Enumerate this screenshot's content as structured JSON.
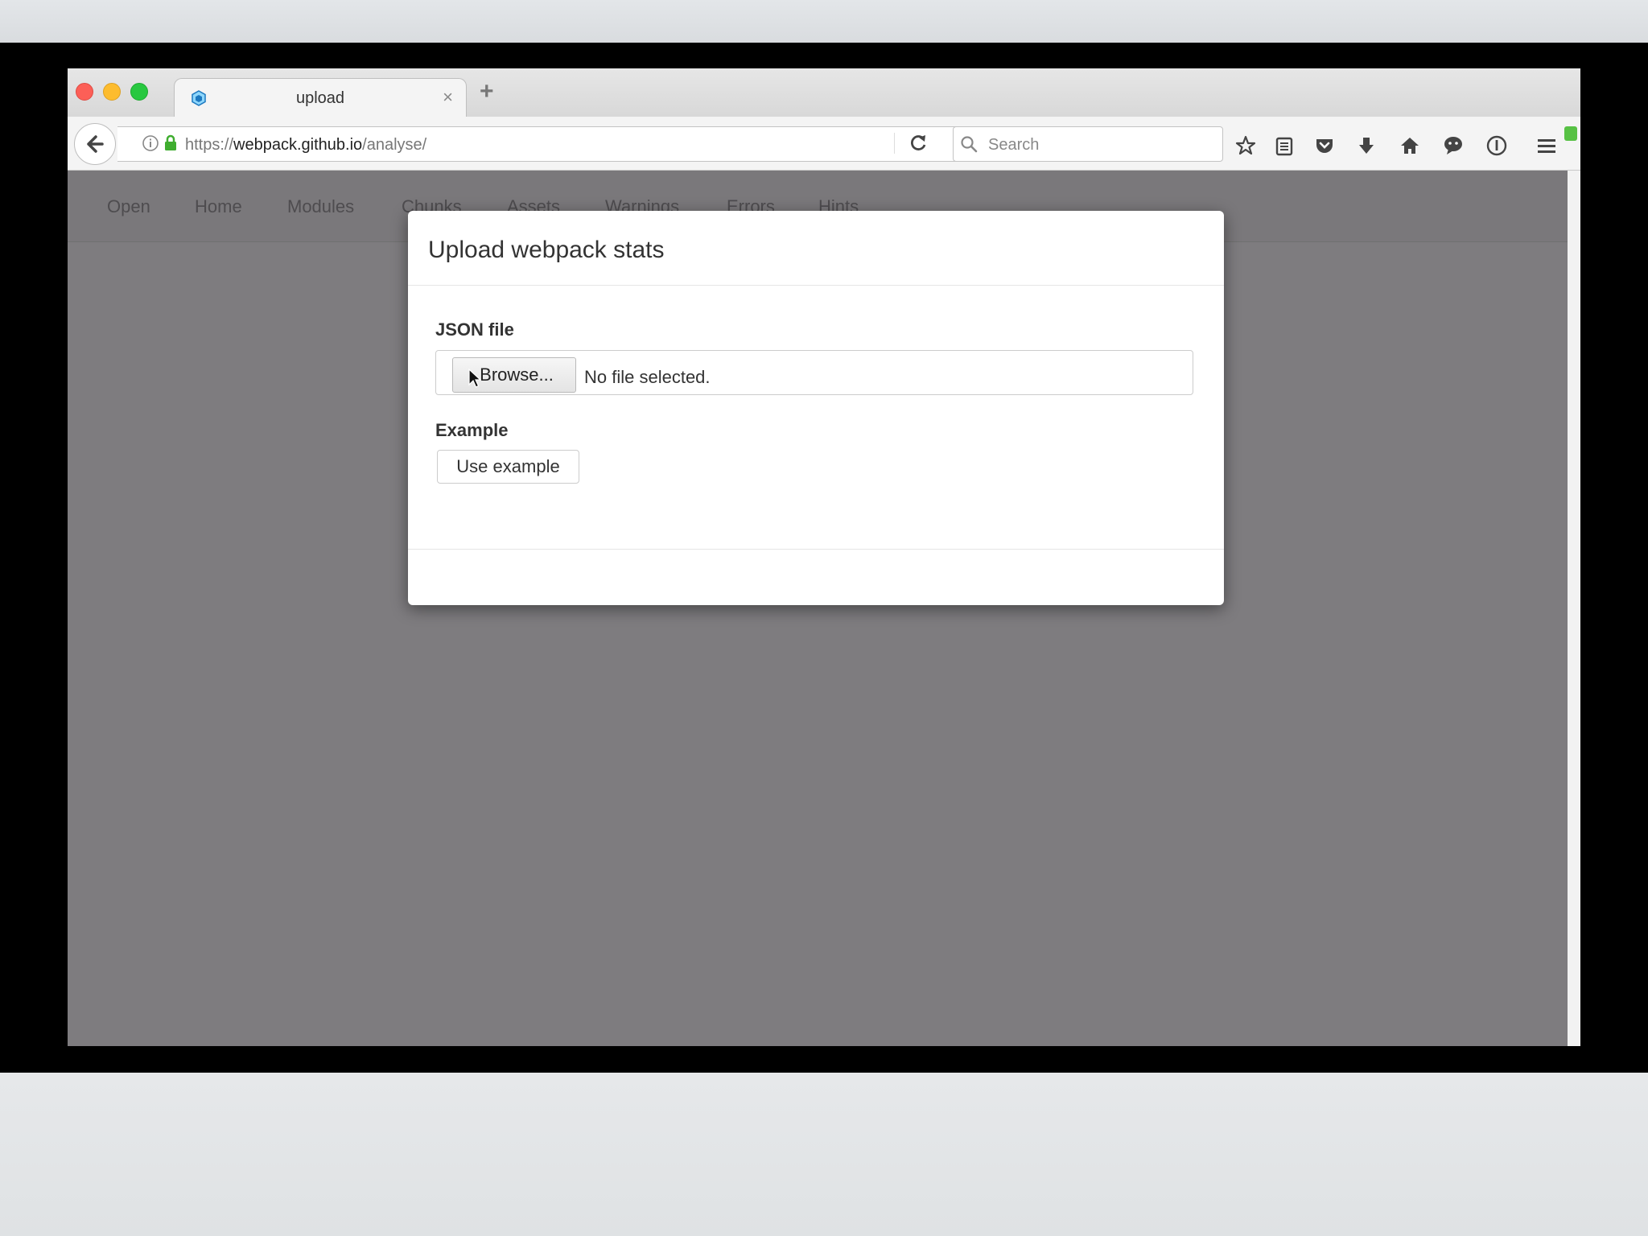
{
  "browser": {
    "tab": {
      "title": "upload",
      "close": "×"
    },
    "new_tab": "+",
    "url": {
      "scheme": "https://",
      "host": "webpack.github.io",
      "path": "/analyse/"
    },
    "search_placeholder": "Search"
  },
  "app": {
    "nav": [
      "Open",
      "Home",
      "Modules",
      "Chunks",
      "Assets",
      "Warnings",
      "Errors",
      "Hints"
    ]
  },
  "modal": {
    "title": "Upload webpack stats",
    "json_label": "JSON file",
    "browse_label": "Browse...",
    "no_file_text": "No file selected.",
    "example_label": "Example",
    "use_example_label": "Use example"
  },
  "colors": {
    "overlay": "#7e7c7f",
    "traffic_red": "#fc5f57",
    "traffic_yellow": "#fdbc2e",
    "traffic_green": "#28c840",
    "menu_badge": "#57c144"
  },
  "icons": [
    "back-arrow-icon",
    "info-icon",
    "lock-icon",
    "reload-icon",
    "search-icon",
    "bookmark-star-icon",
    "reading-list-icon",
    "pocket-icon",
    "download-icon",
    "home-icon",
    "chat-icon",
    "info-circle-icon",
    "hamburger-menu-icon"
  ]
}
